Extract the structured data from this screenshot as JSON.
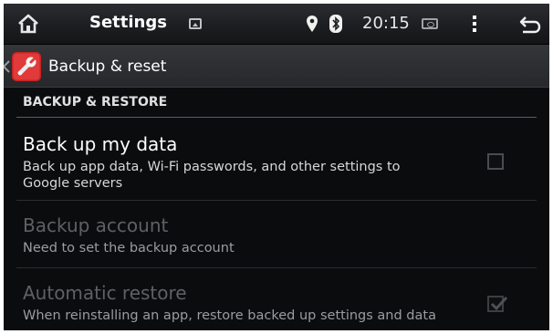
{
  "system_bar": {
    "app_title": "Settings",
    "clock": "20:15",
    "icons": [
      "home-icon",
      "gallery-icon",
      "location-icon",
      "bluetooth-icon",
      "sd-card-icon",
      "overflow-menu-icon",
      "back-icon"
    ]
  },
  "action_bar": {
    "title": "Backup & reset",
    "icon": "wrench-icon"
  },
  "section": {
    "header": "BACKUP & RESTORE"
  },
  "items": [
    {
      "title": "Back up my data",
      "summary": "Back up app data, Wi-Fi passwords, and other settings to Google servers",
      "enabled": true,
      "checked": false
    },
    {
      "title": "Backup account",
      "summary": "Need to set the backup account",
      "enabled": false
    },
    {
      "title": "Automatic restore",
      "summary": "When reinstalling an app, restore backed up settings and data",
      "enabled": false,
      "checked": true
    }
  ]
}
